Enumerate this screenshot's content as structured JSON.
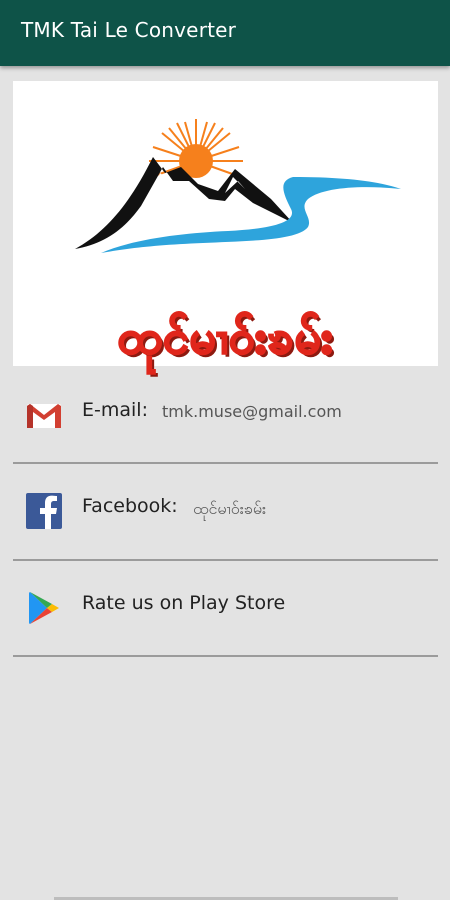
{
  "appbar": {
    "title": "TMK Tai Le Converter"
  },
  "banner": {
    "logo_text": "ထုင်မၢဝ်းၶမ်း",
    "colors": {
      "sun": "#f6801c",
      "water": "#2ea4dc",
      "mountain": "#111111",
      "text_fill": "#f6e21a",
      "text_stroke": "#e0261b"
    }
  },
  "contacts": [
    {
      "icon": "gmail-icon",
      "label": "E-mail:",
      "value": "tmk.muse@gmail.com"
    },
    {
      "icon": "facebook-icon",
      "label": "Facebook:",
      "value": "ထုင်မၢဝ်းၶမ်း"
    },
    {
      "icon": "play-store-icon",
      "label": "Rate us on Play Store"
    }
  ],
  "colors": {
    "appbar": "#0e5348",
    "background": "#e3e3e3",
    "divider": "#9b9b9b"
  }
}
